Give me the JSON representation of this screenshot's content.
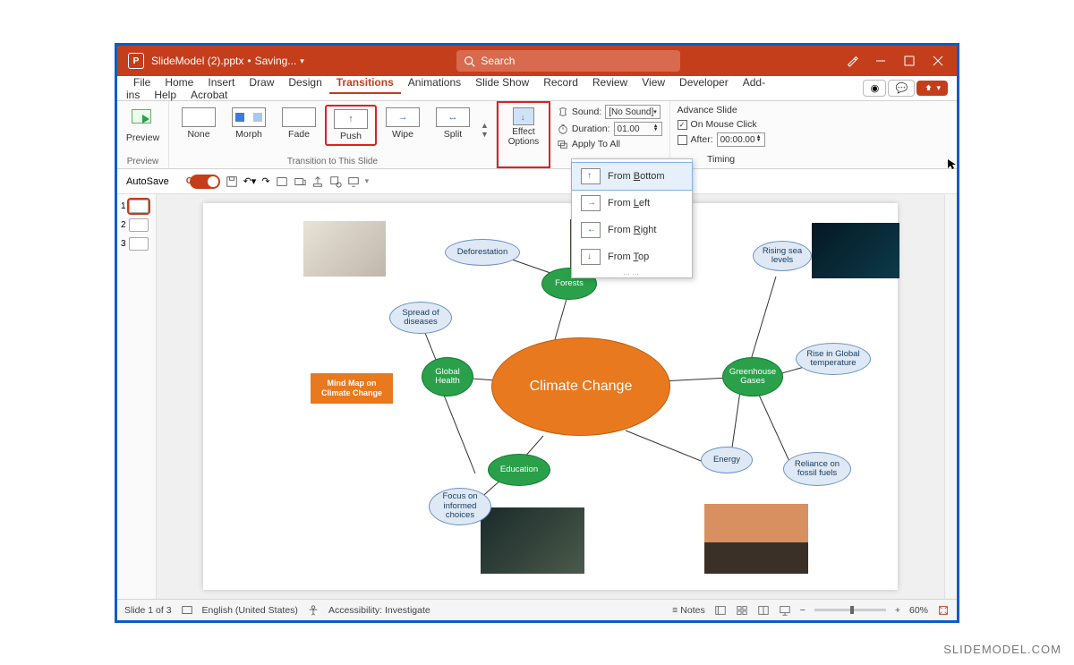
{
  "watermark": "SLIDEMODEL.COM",
  "titlebar": {
    "filename": "SlideModel (2).pptx",
    "status": "Saving...",
    "search_placeholder": "Search"
  },
  "tabs": [
    "File",
    "Home",
    "Insert",
    "Draw",
    "Design",
    "Transitions",
    "Animations",
    "Slide Show",
    "Record",
    "Review",
    "View",
    "Developer",
    "Add-ins",
    "Help",
    "Acrobat"
  ],
  "active_tab": "Transitions",
  "ribbon": {
    "preview_label": "Preview",
    "preview_group": "Preview",
    "transitions": [
      {
        "name": "None"
      },
      {
        "name": "Morph"
      },
      {
        "name": "Fade"
      },
      {
        "name": "Push",
        "highlight": true
      },
      {
        "name": "Wipe"
      },
      {
        "name": "Split"
      }
    ],
    "transition_group": "Transition to This Slide",
    "effect_options": "Effect\nOptions",
    "timing": {
      "sound_label": "Sound:",
      "sound_value": "[No Sound]",
      "duration_label": "Duration:",
      "duration_value": "01.00",
      "apply_all": "Apply To All",
      "advance_title": "Advance Slide",
      "on_click": "On Mouse Click",
      "on_click_checked": true,
      "after_label": "After:",
      "after_value": "00:00.00",
      "group": "Timing"
    }
  },
  "effect_menu": [
    {
      "label": "From Bottom",
      "u": "B",
      "selected": true
    },
    {
      "label": "From Left",
      "u": "L"
    },
    {
      "label": "From Right",
      "u": "R"
    },
    {
      "label": "From Top",
      "u": "T"
    }
  ],
  "qat": {
    "autosave": "AutoSave",
    "on": "On"
  },
  "thumbnails": [
    {
      "n": "1",
      "sel": true
    },
    {
      "n": "2"
    },
    {
      "n": "3"
    }
  ],
  "slide": {
    "center": "Climate Change",
    "tag_l1": "Mind Map on",
    "tag_l2": "Climate Change",
    "green": {
      "forests": "Forests",
      "health": "Global\nHealth",
      "edu": "Education",
      "gases": "Greenhouse\nGases"
    },
    "blue": {
      "deforest": "Deforestation",
      "spread": "Spread of\ndiseases",
      "focus": "Focus on\ninformed\nchoices",
      "energy": "Energy",
      "temp": "Rise in Global\ntemperature",
      "fossil": "Reliance on\nfossil fuels",
      "sea": "Rising sea\nlevels"
    }
  },
  "status": {
    "slide": "Slide 1 of 3",
    "lang": "English (United States)",
    "access": "Accessibility: Investigate",
    "notes": "Notes",
    "zoom": "60%"
  }
}
